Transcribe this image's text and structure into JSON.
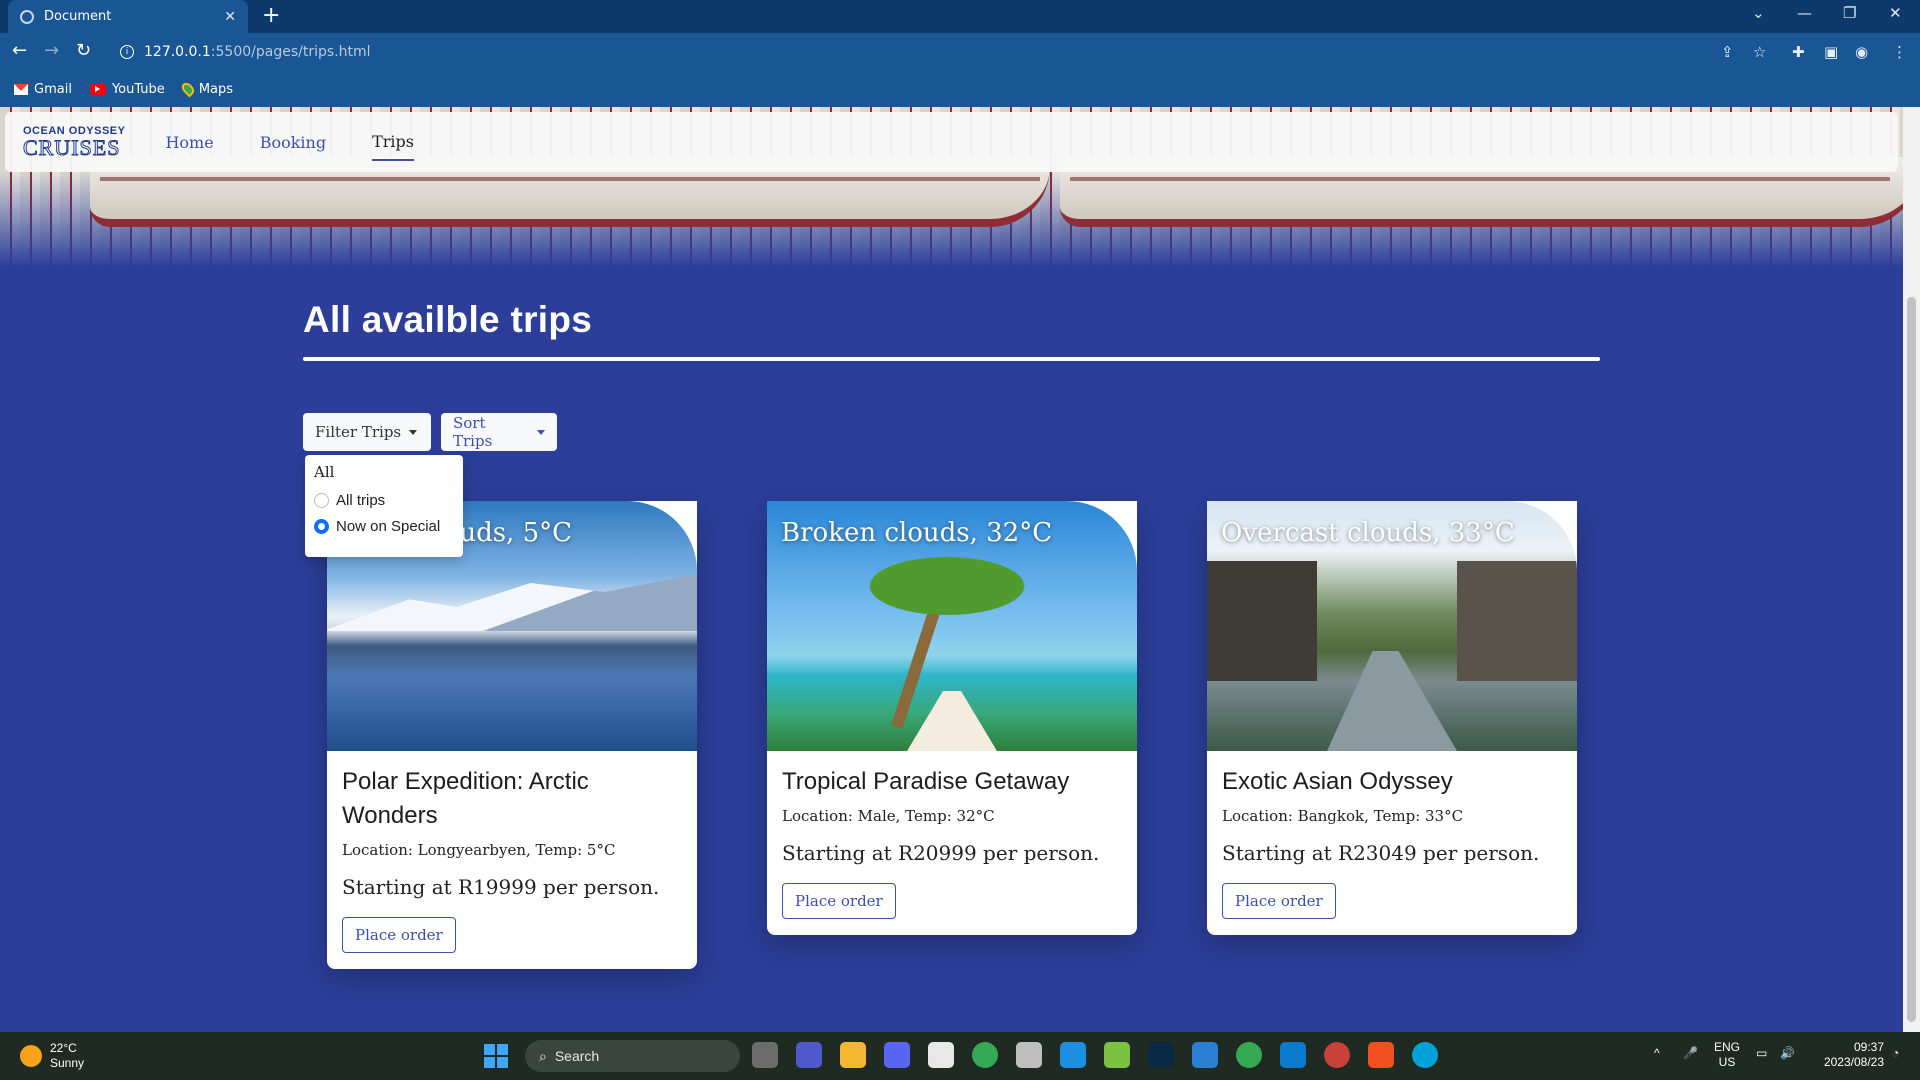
{
  "browser": {
    "tab_title": "Document",
    "tab_close": "✕",
    "new_tab": "+",
    "url_host": "127.0.0.1",
    "url_path": ":5500/pages/trips.html",
    "bookmarks": [
      {
        "label": "Gmail",
        "icon": "gmail-icon"
      },
      {
        "label": "YouTube",
        "icon": "youtube-icon"
      },
      {
        "label": "Maps",
        "icon": "maps-icon"
      }
    ]
  },
  "site": {
    "logo_top": "OCEAN ODYSSEY",
    "logo_bottom": "CRUISES",
    "nav": [
      {
        "label": "Home",
        "active": false
      },
      {
        "label": "Booking",
        "active": false
      },
      {
        "label": "Trips",
        "active": true
      }
    ]
  },
  "main": {
    "title": "All availble trips",
    "filter_label": "Filter Trips",
    "sort_label": "Sort Trips",
    "filter_menu": {
      "header": "All",
      "options": [
        {
          "label": "All trips",
          "checked": false
        },
        {
          "label": "Now on Special",
          "checked": true
        }
      ]
    },
    "trips": [
      {
        "weather": "Clear clouds, 5°C",
        "weather_visible": "louds, 5°C",
        "title": "Polar Expedition: Arctic Wonders",
        "location": "Location: Longyearbyen, Temp: 5°C",
        "price": "Starting at R19999 per person.",
        "button": "Place order"
      },
      {
        "weather": "Broken clouds, 32°C",
        "title": "Tropical Paradise Getaway",
        "location": "Location: Male, Temp: 32°C",
        "price": "Starting at R20999 per person.",
        "button": "Place order"
      },
      {
        "weather": "Overcast clouds, 33°C",
        "title": "Exotic Asian Odyssey",
        "location": "Location: Bangkok, Temp: 33°C",
        "price": "Starting at R23049 per person.",
        "button": "Place order"
      }
    ]
  },
  "taskbar": {
    "weather_temp": "22°C",
    "weather_desc": "Sunny",
    "search_label": "Search",
    "lang_top": "ENG",
    "lang_bottom": "US",
    "time": "09:37",
    "date": "2023/08/23"
  },
  "colors": {
    "page_bg": "#2c3e99",
    "accent": "#3b4fb0",
    "browser_frame": "#1a5694"
  }
}
